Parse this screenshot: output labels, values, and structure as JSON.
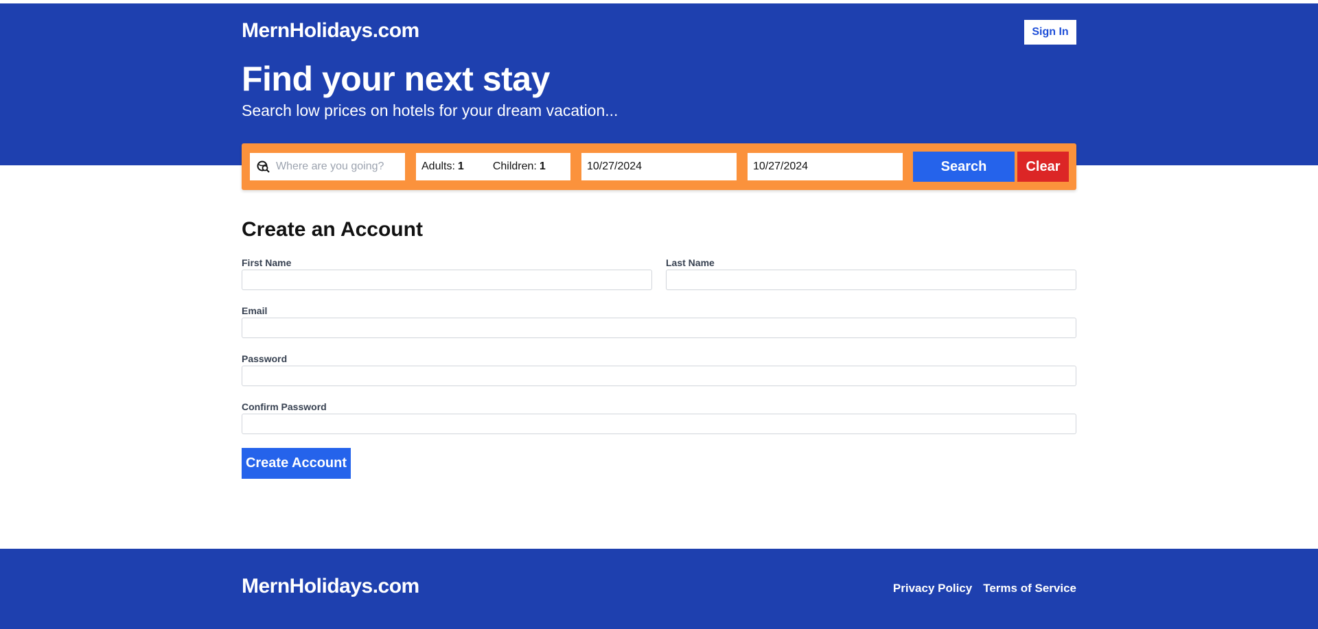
{
  "header": {
    "brand": "MernHolidays.com",
    "sign_in": "Sign In",
    "hero_title": "Find your next stay",
    "hero_subtitle": "Search low prices on hotels for your dream vacation..."
  },
  "search": {
    "destination_placeholder": "Where are you going?",
    "adults_label": "Adults:",
    "adults_value": "1",
    "children_label": "Children:",
    "children_value": "1",
    "check_in": "10/27/2024",
    "check_out": "10/27/2024",
    "search_label": "Search",
    "clear_label": "Clear"
  },
  "form": {
    "title": "Create an Account",
    "first_name_label": "First Name",
    "last_name_label": "Last Name",
    "email_label": "Email",
    "password_label": "Password",
    "confirm_password_label": "Confirm Password",
    "submit_label": "Create Account"
  },
  "footer": {
    "brand": "MernHolidays.com",
    "privacy": "Privacy Policy",
    "terms": "Terms of Service"
  },
  "colors": {
    "primary_blue": "#1e40af",
    "button_blue": "#2563eb",
    "search_bar_orange": "#fb923c",
    "clear_red": "#dc2626"
  }
}
